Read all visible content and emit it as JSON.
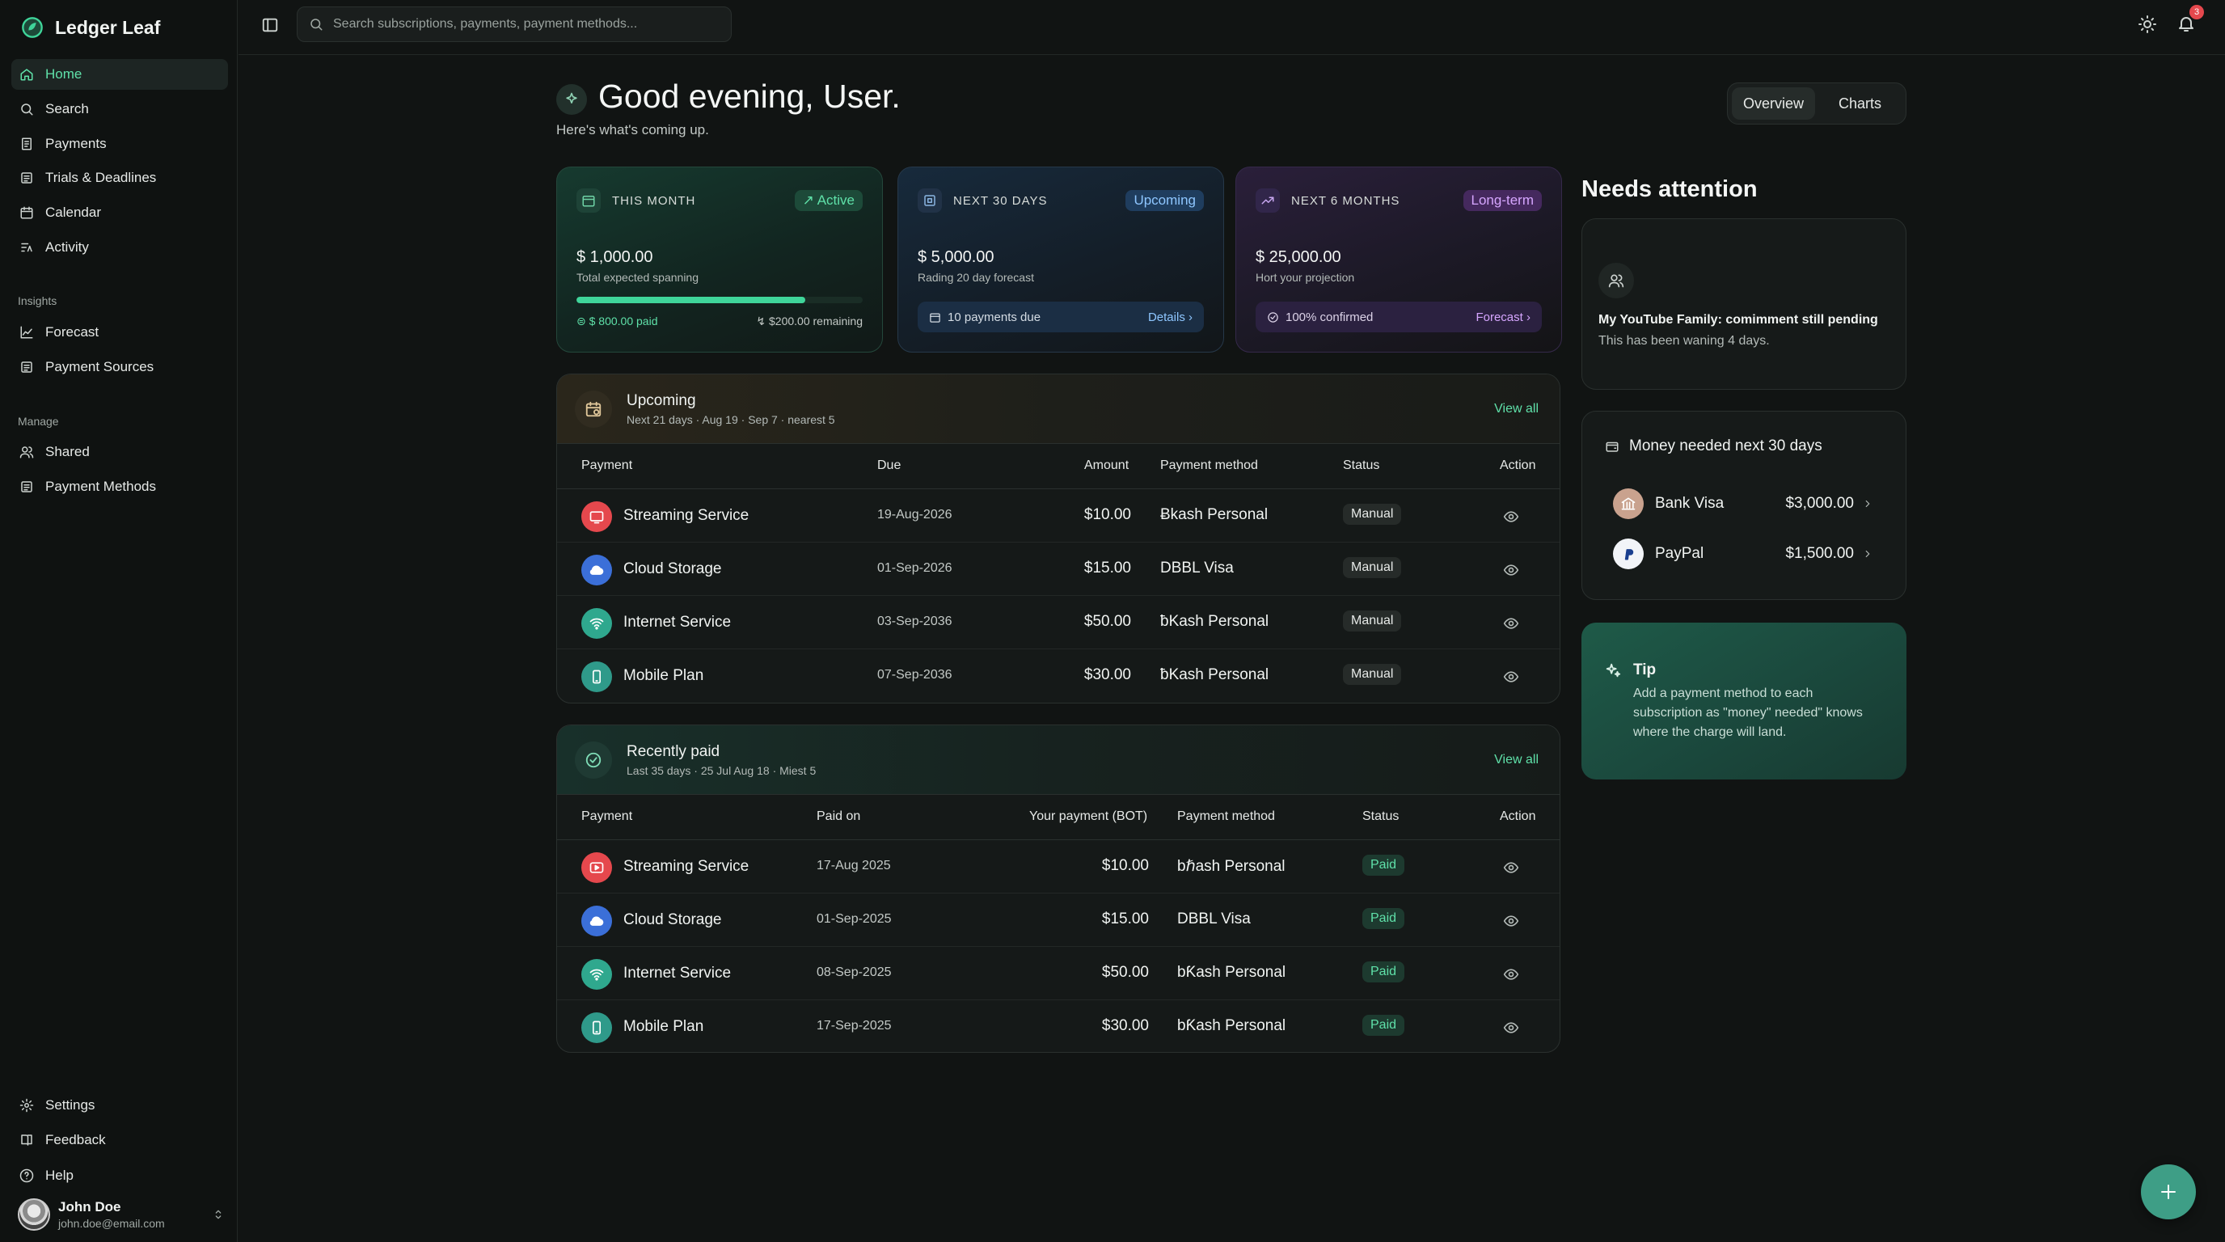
{
  "app": {
    "name": "Ledger Leaf"
  },
  "sidebar": {
    "nav": [
      {
        "label": "Home",
        "icon": "home-icon",
        "active": true
      },
      {
        "label": "Search",
        "icon": "search-icon"
      },
      {
        "label": "Payments",
        "icon": "receipt-icon"
      },
      {
        "label": "Trials & Deadlines",
        "icon": "hourglass-icon"
      },
      {
        "label": "Calendar",
        "icon": "calendar-icon"
      },
      {
        "label": "Activity",
        "icon": "activity-icon"
      }
    ],
    "insights_label": "Insights",
    "insights": [
      {
        "label": "Forecast",
        "icon": "chart-line-icon"
      },
      {
        "label": "Payment Sources",
        "icon": "wallet-icon"
      }
    ],
    "manage_label": "Manage",
    "manage": [
      {
        "label": "Shared",
        "icon": "users-icon"
      },
      {
        "label": "Payment Methods",
        "icon": "card-icon"
      }
    ],
    "footer": [
      {
        "label": "Settings",
        "icon": "gear-icon"
      },
      {
        "label": "Feedback",
        "icon": "book-icon"
      },
      {
        "label": "Help",
        "icon": "help-icon"
      }
    ],
    "user": {
      "name": "John Doe",
      "email": "john.doe@email.com"
    }
  },
  "topbar": {
    "search_placeholder": "Search subscriptions, payments, payment methods...",
    "notification_count": "3"
  },
  "header": {
    "greeting": "Good evening, User.",
    "subtitle": "Here's what's coming up.",
    "tabs": [
      "Overview",
      "Charts"
    ],
    "active_tab": "Overview"
  },
  "stats": [
    {
      "label": "THIS MONTH",
      "badge": "Active",
      "amount": "$ 1,000.00",
      "sub": "Total expected spanning",
      "progress": 0.8,
      "paid": "$ 800.00 paid",
      "remaining": "$200.00 remaining"
    },
    {
      "label": "NEXT 30 DAYS",
      "badge": "Upcoming",
      "amount": "$ 5,000.00",
      "sub": "Rading 20 day forecast",
      "pill_text": "10 payments due",
      "pill_link": "Details"
    },
    {
      "label": "NEXT 6 MONTHS",
      "badge": "Long-term",
      "amount": "$ 25,000.00",
      "sub": "Hort your projection",
      "pill_text": "100% confirmed",
      "pill_link": "Forecast"
    }
  ],
  "upcoming": {
    "title": "Upcoming",
    "subtitle": "Next 21 days · Aug 19 · Sep 7 · nearest 5",
    "view_all": "View all",
    "columns": [
      "Payment",
      "Due",
      "Amount",
      "Payment method",
      "Status",
      "Action"
    ],
    "rows": [
      {
        "name": "Streaming Service",
        "icon": "tv-icon",
        "color": "#e5484d",
        "date": "19-Aug-2026",
        "amount": "$10.00",
        "method": "Ƀkash Personal",
        "status": "Manual"
      },
      {
        "name": "Cloud Storage",
        "icon": "cloud-icon",
        "color": "#3b6fd8",
        "date": "01-Sep-2026",
        "amount": "$15.00",
        "method": "DBBL Visa",
        "status": "Manual"
      },
      {
        "name": "Internet Service",
        "icon": "wifi-icon",
        "color": "#2fa88e",
        "date": "03-Sep-2036",
        "amount": "$50.00",
        "method": "ƀKash Personal",
        "status": "Manual"
      },
      {
        "name": "Mobile Plan",
        "icon": "phone-icon",
        "color": "#2f9a8a",
        "date": "07-Sep-2036",
        "amount": "$30.00",
        "method": "ƀKash Personal",
        "status": "Manual"
      }
    ]
  },
  "recent": {
    "title": "Recently paid",
    "subtitle": "Last 35 days · 25 Jul Aug 18 · Miest 5",
    "view_all": "View all",
    "columns": [
      "Payment",
      "Paid on",
      "Your payment (BOT)",
      "Payment method",
      "Status",
      "Action"
    ],
    "rows": [
      {
        "name": "Streaming Service",
        "icon": "play-icon",
        "color": "#e5484d",
        "date": "17-Aug 2025",
        "amount": "$10.00",
        "method": "bℏash Personal",
        "status": "Paid"
      },
      {
        "name": "Cloud Storage",
        "icon": "cloud-icon",
        "color": "#3b6fd8",
        "date": "01-Sep-2025",
        "amount": "$15.00",
        "method": "DBBL Visa",
        "status": "Paid"
      },
      {
        "name": "Internet Service",
        "icon": "wifi-icon",
        "color": "#2fa88e",
        "date": "08-Sep-2025",
        "amount": "$50.00",
        "method": "bƘash Personal",
        "status": "Paid"
      },
      {
        "name": "Mobile Plan",
        "icon": "phone-icon",
        "color": "#2f9a8a",
        "date": "17-Sep-2025",
        "amount": "$30.00",
        "method": "bƘash Personal",
        "status": "Paid"
      }
    ]
  },
  "needs_attention": {
    "title": "Needs attention",
    "item_title": "My YouTube Family: comimment still pending",
    "item_sub": "This has been waning 4 days."
  },
  "money_needed": {
    "title": "Money needed next 30 days",
    "rows": [
      {
        "name": "Bank Visa",
        "amount": "$3,000.00",
        "icon": "bank-icon"
      },
      {
        "name": "PayPal",
        "amount": "$1,500.00",
        "icon": "paypal-icon"
      }
    ]
  },
  "tip": {
    "title": "Tip",
    "text": "Add a payment method to each subscription as \"money\" needed\" knows where the charge will land."
  },
  "colors": {
    "accent": "#3fd59a",
    "background": "#111413",
    "badge_red": "#e5484d"
  }
}
